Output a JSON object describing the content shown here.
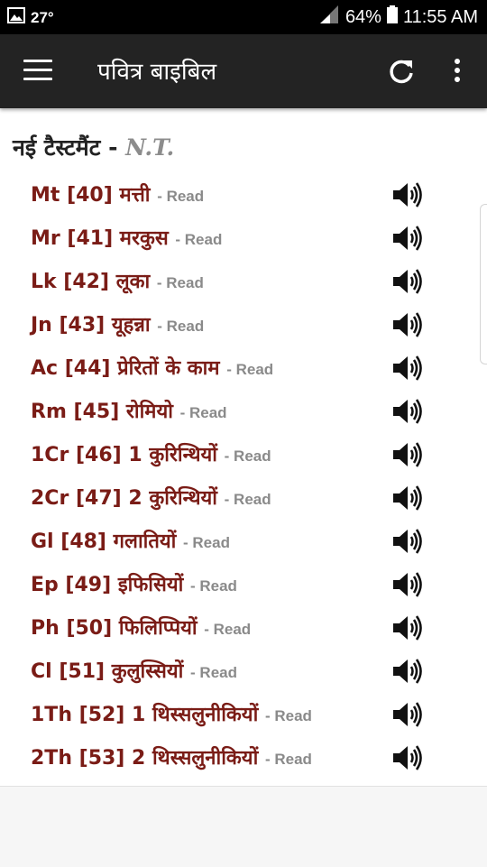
{
  "status_bar": {
    "temperature": "27°",
    "battery": "64%",
    "time": "11:55 AM",
    "icons": [
      "image-icon",
      "signal-icon",
      "battery-icon"
    ]
  },
  "toolbar": {
    "title": "पवित्र बाइबिल",
    "icons": [
      "menu-icon",
      "refresh-icon",
      "more-vert-icon"
    ],
    "background": "#232323"
  },
  "section": {
    "title": "नई टैस्टमैंट",
    "separator": "-",
    "abbr": "N.T."
  },
  "colors": {
    "book_text": "#7a1c16",
    "read_text": "#8a8a8a"
  },
  "books": [
    {
      "label": "Mt [40] मत्ती",
      "read": "- Read"
    },
    {
      "label": "Mr [41] मरकुस",
      "read": "- Read"
    },
    {
      "label": "Lk [42] लूका",
      "read": "- Read"
    },
    {
      "label": "Jn [43] यूहन्ना",
      "read": "- Read"
    },
    {
      "label": "Ac [44] प्रेरितों के काम",
      "read": "- Read"
    },
    {
      "label": "Rm [45] रोमियो",
      "read": "- Read"
    },
    {
      "label": "1Cr [46] 1 कुरिन्थियों",
      "read": "- Read"
    },
    {
      "label": "2Cr [47] 2 कुरिन्थियों",
      "read": "- Read"
    },
    {
      "label": "Gl [48] गलातियों",
      "read": "- Read"
    },
    {
      "label": "Ep [49] इफिसियों",
      "read": "- Read"
    },
    {
      "label": "Ph [50] फिलिप्पियों",
      "read": "- Read"
    },
    {
      "label": "Cl [51] कुलुस्सियों",
      "read": "- Read"
    },
    {
      "label": "1Th [52] 1 थिस्सलुनीकियों",
      "read": "- Read"
    },
    {
      "label": "2Th [53] 2 थिस्सलुनीकियों",
      "read": "- Read"
    }
  ]
}
